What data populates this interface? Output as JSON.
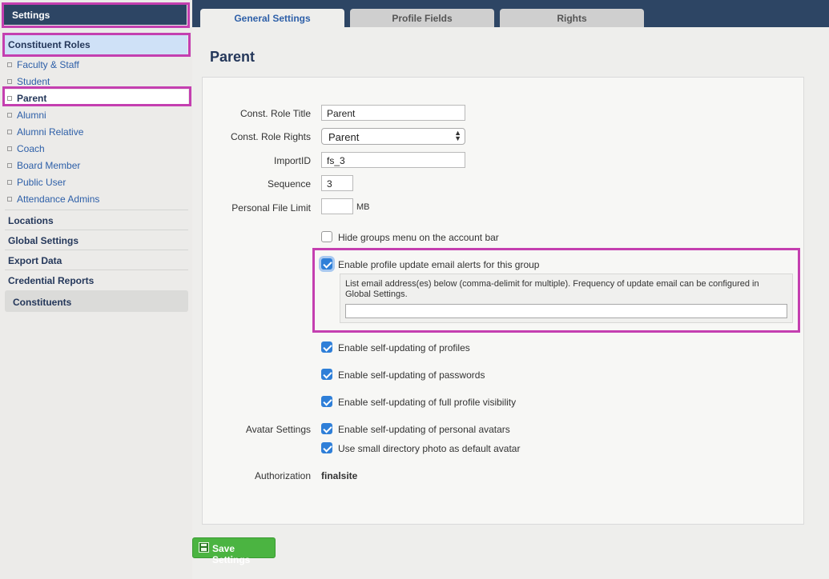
{
  "sidebar": {
    "settings_label": "Settings",
    "roles_label": "Constituent Roles",
    "roles": [
      {
        "label": "Faculty & Staff"
      },
      {
        "label": "Student"
      },
      {
        "label": "Parent"
      },
      {
        "label": "Alumni"
      },
      {
        "label": "Alumni Relative"
      },
      {
        "label": "Coach"
      },
      {
        "label": "Board Member"
      },
      {
        "label": "Public User"
      },
      {
        "label": "Attendance Admins"
      }
    ],
    "sections": [
      {
        "label": "Locations"
      },
      {
        "label": "Global Settings"
      },
      {
        "label": "Export Data"
      },
      {
        "label": "Credential Reports"
      }
    ],
    "constituents_label": "Constituents"
  },
  "tabs": [
    {
      "label": "General Settings"
    },
    {
      "label": "Profile Fields"
    },
    {
      "label": "Rights"
    }
  ],
  "page_title": "Parent",
  "form": {
    "role_title_label": "Const. Role Title",
    "role_title_value": "Parent",
    "role_rights_label": "Const. Role Rights",
    "role_rights_value": "Parent",
    "import_id_label": "ImportID",
    "import_id_value": "fs_3",
    "sequence_label": "Sequence",
    "sequence_value": "3",
    "file_limit_label": "Personal File Limit",
    "file_limit_value": "",
    "file_limit_unit": "MB",
    "hide_groups_label": "Hide groups menu on the account bar",
    "email_alerts_label": "Enable profile update email alerts for this group",
    "email_alerts_help": "List email address(es) below (comma-delimit for multiple). Frequency of update email can be configured in Global Settings.",
    "email_alerts_value": "",
    "self_profiles_label": "Enable self-updating of profiles",
    "self_passwords_label": "Enable self-updating of passwords",
    "self_visibility_label": "Enable self-updating of full profile visibility",
    "avatar_settings_label": "Avatar Settings",
    "self_avatars_label": "Enable self-updating of personal avatars",
    "small_photo_label": "Use small directory photo as default avatar",
    "authorization_label": "Authorization",
    "authorization_value": "finalsite"
  },
  "save_label": "Save Settings",
  "colors": {
    "header": "#2d4564",
    "highlight": "#c43fb0",
    "link": "#2d5fa8",
    "checkbox": "#2f7fd8",
    "save": "#4bb441"
  }
}
